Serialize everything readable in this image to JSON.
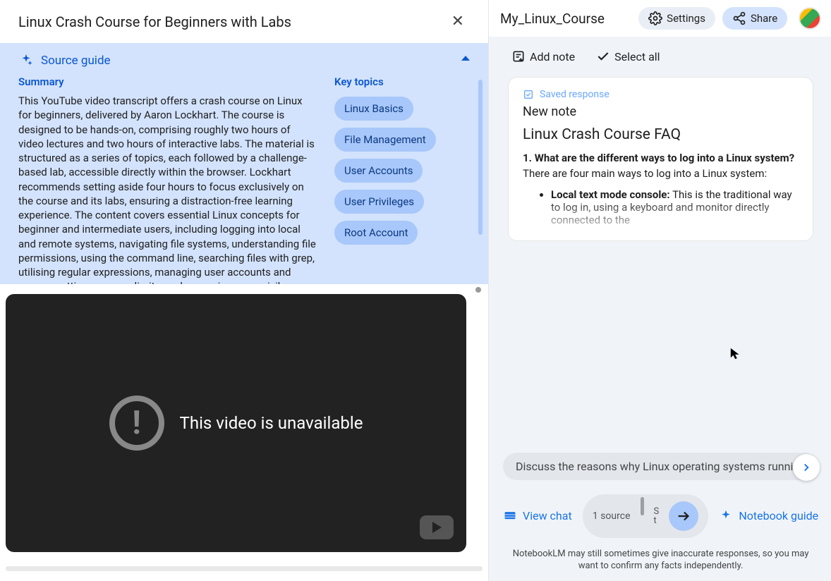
{
  "left": {
    "title": "Linux Crash Course for Beginners with Labs",
    "source_guide_label": "Source guide",
    "summary_label": "Summary",
    "summary_text": "This YouTube video transcript offers a crash course on Linux for beginners, delivered by Aaron Lockhart. The course is designed to be hands-on, comprising roughly two hours of video lectures and two hours of interactive labs. The material is structured as a series of topics, each followed by a challenge-based lab, accessible directly within the browser. Lockhart recommends setting aside four hours to focus exclusively on the course and its labs, ensuring a distraction-free learning experience. The content covers essential Linux concepts for beginner and intermediate users, including logging into local and remote systems, navigating file systems, understanding file permissions, using the command line, searching files with grep, utilising regular expressions, managing user accounts and groups, setting resource limits, and managing user privileges. The course emphasizes practical",
    "key_topics_label": "Key topics",
    "topics": [
      "Linux Basics",
      "File Management",
      "User Accounts",
      "User Privileges",
      "Root Account"
    ],
    "video_error": "This video is unavailable"
  },
  "right": {
    "notebook_title": "My_Linux_Course",
    "settings_label": "Settings",
    "share_label": "Share",
    "add_note_label": "Add note",
    "select_all_label": "Select all",
    "note": {
      "saved_label": "Saved response",
      "new_note_label": "New note",
      "heading": "Linux Crash Course FAQ",
      "question_number": "1.",
      "question_text": "What are the different ways to log into a Linux system?",
      "intro": "There are four main ways to log into a Linux system:",
      "bullet_lead": "Local text mode console:",
      "bullet_rest": " This is the traditional way to log in, using a keyboard and monitor directly connected to the"
    },
    "suggestion": "Discuss the reasons why Linux operating systems running",
    "view_chat_label": "View chat",
    "source_count": "1 source",
    "stacked_letters_1": "S",
    "stacked_letters_2": "t",
    "notebook_guide_label": "Notebook guide",
    "disclaimer": "NotebookLM may still sometimes give inaccurate responses, so you may want to confirm any facts independently."
  }
}
